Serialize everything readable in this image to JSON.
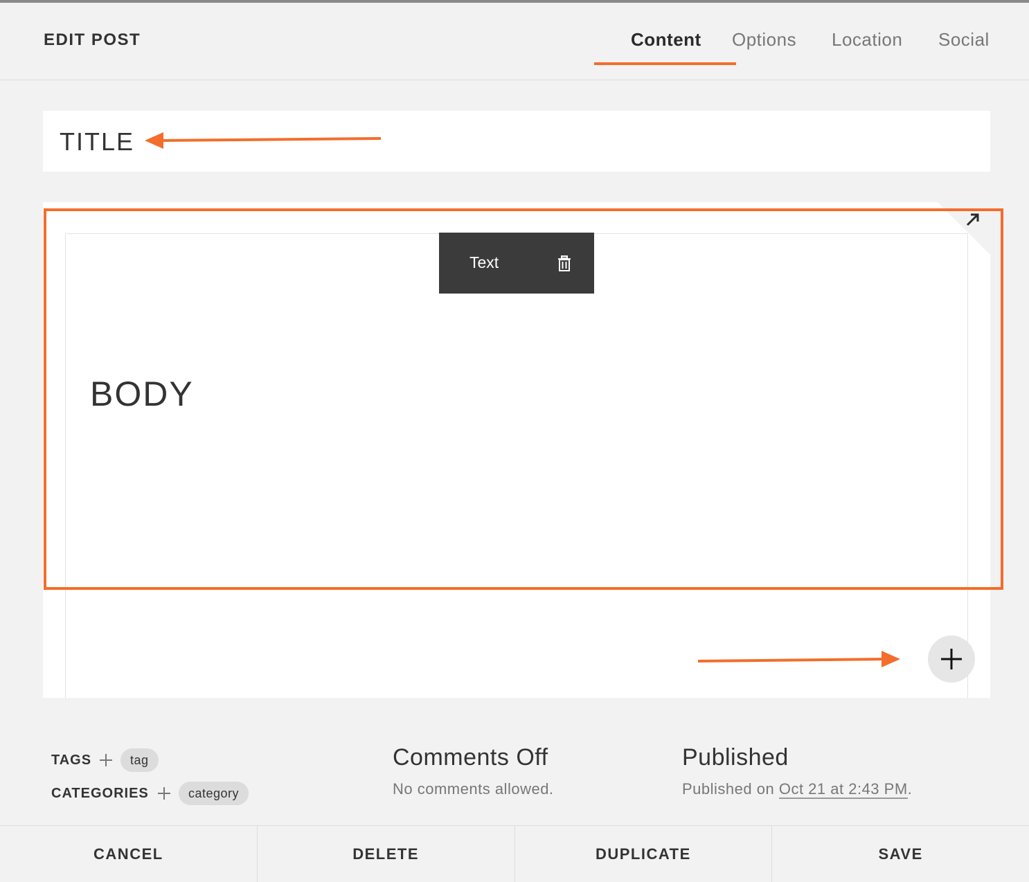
{
  "header": {
    "title": "EDIT POST",
    "tabs": [
      {
        "label": "Content",
        "active": true
      },
      {
        "label": "Options",
        "active": false
      },
      {
        "label": "Location",
        "active": false
      },
      {
        "label": "Social",
        "active": false
      }
    ]
  },
  "post": {
    "title": "TITLE",
    "body": "BODY"
  },
  "block_toolbar": {
    "label": "Text",
    "icon": "trash-icon"
  },
  "meta": {
    "tags_label": "TAGS",
    "tag": "tag",
    "categories_label": "CATEGORIES",
    "category": "category",
    "comments_heading": "Comments Off",
    "comments_sub": "No comments allowed.",
    "status_heading": "Published",
    "status_prefix": "Published on ",
    "status_date": "Oct 21 at 2:43 PM",
    "status_suffix": "."
  },
  "footer": {
    "cancel": "CANCEL",
    "delete": "DELETE",
    "duplicate": "DUPLICATE",
    "save": "SAVE"
  },
  "colors": {
    "accent": "#f36d2c",
    "toolbar_bg": "#3b3b3b",
    "page_bg": "#f2f2f2"
  }
}
